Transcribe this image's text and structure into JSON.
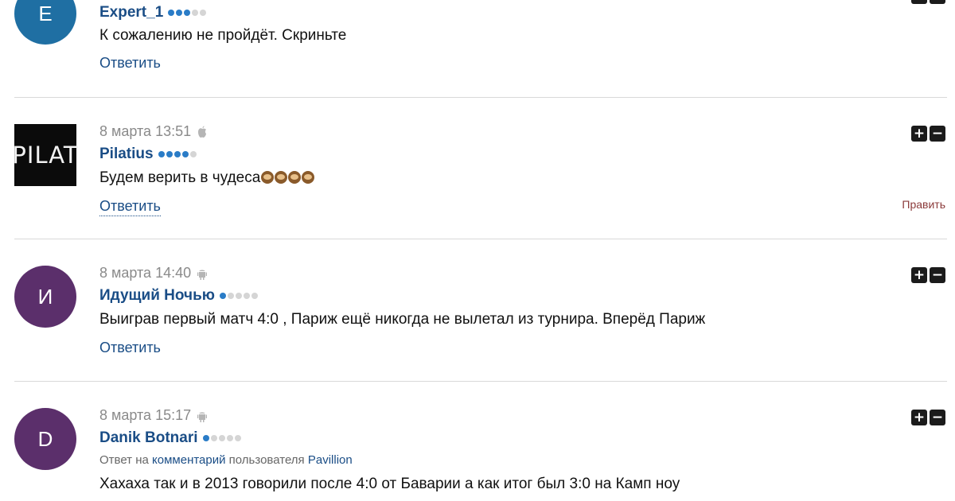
{
  "comments": [
    {
      "avatar_letter": "E",
      "avatar_color": "#1f6fa3",
      "author": "Expert_1",
      "rank_on": 3,
      "text": "К сожалению не пройдёт. Скриньте",
      "reply_label": "Ответить"
    },
    {
      "avatar_text": "PILAT",
      "date": "8 марта 13:51",
      "device_icon": "apple-icon",
      "author": "Pilatius",
      "rank_on": 4,
      "text": "Будем верить в чудеса",
      "emoji_icons": [
        "monkey-see-no-evil-icon",
        "monkey-hear-no-evil-icon",
        "monkey-speak-no-evil-icon",
        "monkey-see-no-evil-icon"
      ],
      "reply_label": "Ответить",
      "edit_label": "Править"
    },
    {
      "avatar_letter": "И",
      "avatar_color": "#5b2f6b",
      "date": "8 марта 14:40",
      "device_icon": "android-icon",
      "author": "Идущий Ночью",
      "rank_on": 1,
      "text": "Выиграв первый матч 4:0 , Париж ещё никогда не вылетал из турнира. Вперёд Париж",
      "reply_label": "Ответить"
    },
    {
      "avatar_letter": "D",
      "avatar_color": "#5b2f6b",
      "date": "8 марта 15:17",
      "device_icon": "android-icon",
      "author": "Danik Botnari",
      "rank_on": 1,
      "reply_prefix": "Ответ на",
      "reply_link": "комментарий",
      "reply_mid": "пользователя",
      "reply_user": "Pavillion",
      "text": "Хахаха так и в 2013 говорили после 4:0 от Баварии а как итог был 3:0 на Камп ноу"
    }
  ],
  "vote_plus": "+",
  "vote_minus": "−"
}
